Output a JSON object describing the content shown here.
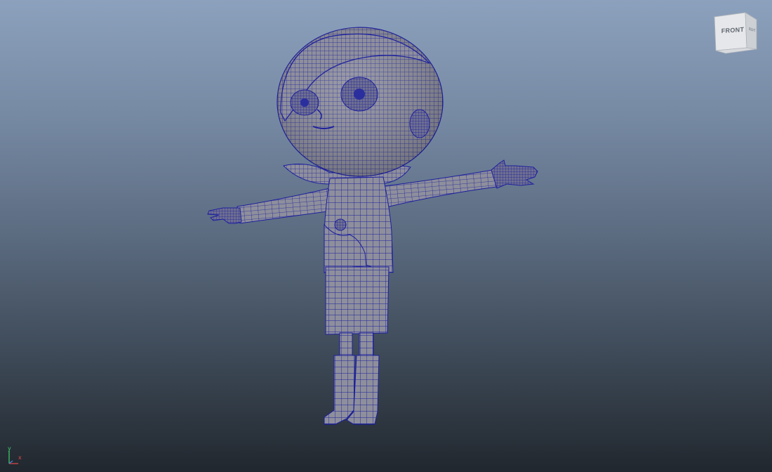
{
  "viewport": {
    "view_cube": {
      "front_label": "FRONT",
      "right_label": "RIGHT"
    },
    "axis_indicator": {
      "y_label": "y",
      "x_label": "x",
      "y_color": "#3fd36b",
      "x_color": "#e24a4a"
    },
    "model": {
      "wireframe_color": "#1c1f9e",
      "surface_color": "#8e8f9c"
    },
    "background": {
      "top_color": "#8ca1bd",
      "bottom_color": "#21272e"
    }
  }
}
